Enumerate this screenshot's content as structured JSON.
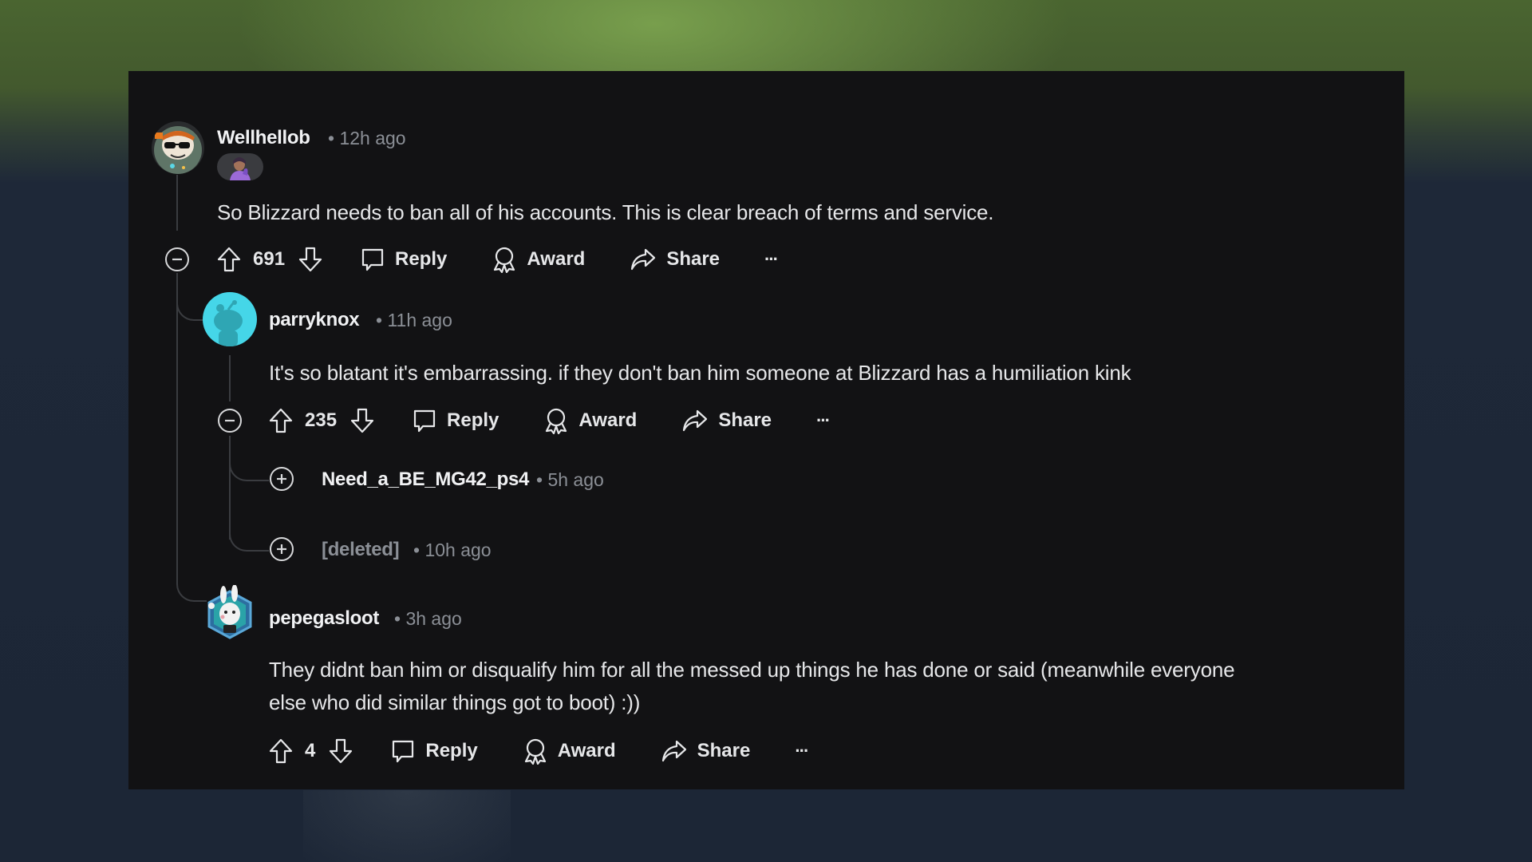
{
  "background": {
    "top_color": "#4a6530",
    "bottom_color": "#1c2636"
  },
  "panel": {
    "background": "#121214"
  },
  "comments": [
    {
      "username": "Wellhellob",
      "meta": "• 12h ago",
      "flair": "character-flair-icon",
      "body": "So Blizzard needs to ban all of his accounts. This is clear breach of terms and service.",
      "score": "691",
      "collapse_state": "expanded",
      "actions": {
        "reply": "Reply",
        "award": "Award",
        "share": "Share",
        "more": "···"
      },
      "avatar": "sunglasses-avatar-icon"
    },
    {
      "username": "parryknox",
      "meta": "• 11h ago",
      "body": "It's so blatant it's embarrassing. if they don't ban him someone at Blizzard has a humiliation kink",
      "score": "235",
      "collapse_state": "expanded",
      "actions": {
        "reply": "Reply",
        "award": "Award",
        "share": "Share",
        "more": "···"
      },
      "avatar": "default-snoo-avatar-icon",
      "avatar_color": "#45d6e8"
    },
    {
      "username": "Need_a_BE_MG42_ps4",
      "meta": "• 5h ago",
      "collapse_state": "collapsed"
    },
    {
      "username": "[deleted]",
      "meta": "• 10h ago",
      "collapse_state": "collapsed"
    },
    {
      "username": "pepegasloot",
      "meta": "• 3h ago",
      "body_lines": [
        "They didnt ban him or disqualify him for all the messed up things he has done or said (meanwhile everyone",
        "else who did similar things got to boot) :))"
      ],
      "score": "4",
      "actions": {
        "reply": "Reply",
        "award": "Award",
        "share": "Share",
        "more": "···"
      },
      "avatar": "bunny-hex-avatar-icon"
    }
  ]
}
